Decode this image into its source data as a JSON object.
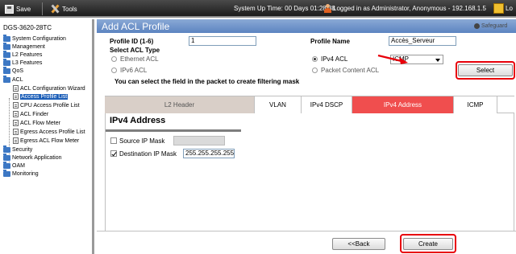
{
  "topbar": {
    "save_label": "Save",
    "tools_label": "Tools",
    "status_text": "System Up Time: 00 Days 01:28:38",
    "user_text": "Logged in as Administrator, Anonymous - 192.168.1.5",
    "logout_label": "Lo"
  },
  "sidebar": {
    "device_name": "DGS-3620-28TC",
    "items": [
      {
        "label": "System Configuration",
        "type": "folder"
      },
      {
        "label": "Management",
        "type": "folder"
      },
      {
        "label": "L2 Features",
        "type": "folder"
      },
      {
        "label": "L3 Features",
        "type": "folder"
      },
      {
        "label": "QoS",
        "type": "folder"
      },
      {
        "label": "ACL",
        "type": "folder"
      },
      {
        "label": "ACL Configuration Wizard",
        "type": "doc"
      },
      {
        "label": "Access Profile List",
        "type": "doc",
        "selected": true
      },
      {
        "label": "CPU Access Profile List",
        "type": "doc"
      },
      {
        "label": "ACL Finder",
        "type": "doc"
      },
      {
        "label": "ACL Flow Meter",
        "type": "doc"
      },
      {
        "label": "Egress Access Profile List",
        "type": "doc"
      },
      {
        "label": "Egress ACL Flow Meter",
        "type": "doc"
      },
      {
        "label": "Security",
        "type": "folder"
      },
      {
        "label": "Network Application",
        "type": "folder"
      },
      {
        "label": "OAM",
        "type": "folder"
      },
      {
        "label": "Monitoring",
        "type": "folder"
      }
    ]
  },
  "main": {
    "title": "Add ACL Profile",
    "safeguard_label": "Safeguard",
    "profile_id_label": "Profile ID (1-6)",
    "profile_id_value": "1",
    "profile_name_label": "Profile Name",
    "profile_name_value": "Accès_Serveur",
    "acl_type_label": "Select ACL Type",
    "acl_types": {
      "ethernet": "Ethernet ACL",
      "ipv6": "IPv6 ACL",
      "ipv4": "IPv4 ACL",
      "packet_content": "Packet Content ACL"
    },
    "selected_acl_type": "ipv4",
    "protocol_select_value": "ICMP",
    "select_button": "Select",
    "hint_text": "You can select the field in the packet to create filtering mask",
    "tabs": [
      "L2 Header",
      "VLAN",
      "IPv4 DSCP",
      "IPv4 Address",
      "ICMP"
    ],
    "active_tab": "IPv4 Address",
    "section_title": "IPv4 Address",
    "source_ip_mask_label": "Source IP Mask",
    "source_ip_mask_checked": false,
    "source_ip_mask_value": "",
    "destination_ip_mask_label": "Destination IP Mask",
    "destination_ip_mask_checked": true,
    "destination_ip_mask_value": "255.255.255.255",
    "back_button": "<<Back",
    "create_button": "Create"
  },
  "colors": {
    "highlight": "#e8000a",
    "active_tab": "#f04e4e",
    "header_blue": "#6e93c9",
    "selected_item": "#1d5fb8"
  }
}
